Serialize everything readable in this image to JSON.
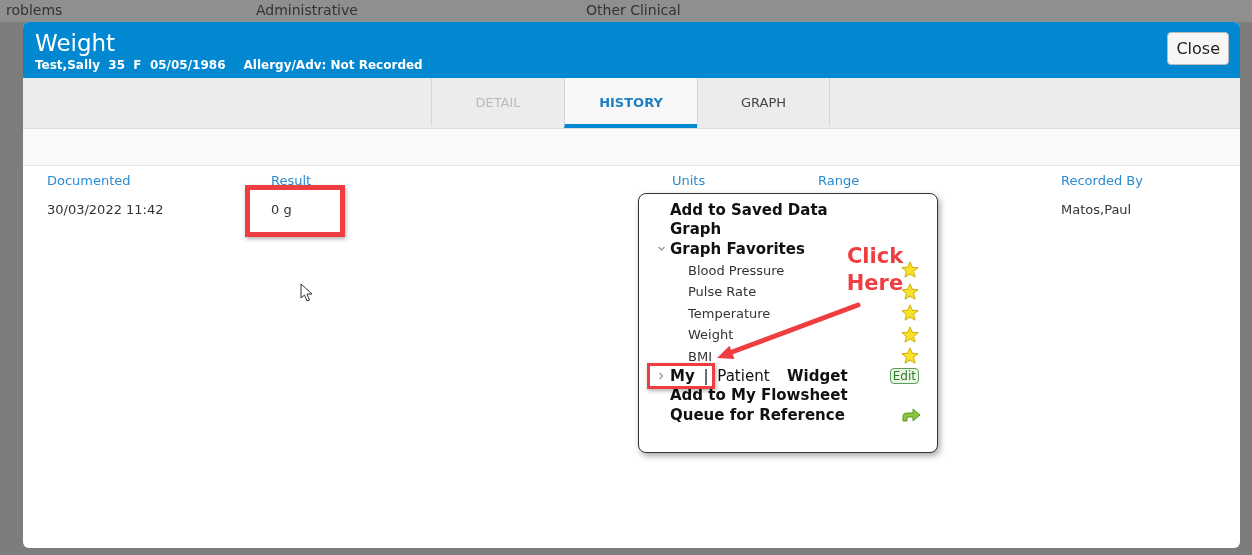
{
  "backdrop": {
    "tabs": [
      {
        "label": "roblems"
      },
      {
        "label": "Administrative"
      },
      {
        "label": "Other Clinical"
      }
    ]
  },
  "window": {
    "title": "Weight",
    "patient": "Test,Sally  35  F  05/05/1986",
    "allergy": "Allergy/Adv: Not Recorded",
    "close": "Close"
  },
  "tabs": [
    {
      "label": "DETAIL",
      "selected": false,
      "disabled": true
    },
    {
      "label": "HISTORY",
      "selected": true,
      "disabled": false
    },
    {
      "label": "GRAPH",
      "selected": false,
      "disabled": false
    }
  ],
  "table": {
    "columns": [
      "Documented",
      "Result",
      "Units",
      "Range",
      "Recorded By"
    ],
    "rows": [
      [
        "30/03/2022 11:42",
        "0 g",
        "",
        "",
        "Matos,Paul"
      ]
    ]
  },
  "context_menu": {
    "items": [
      {
        "kind": "action",
        "label": "Add to Saved Data"
      },
      {
        "kind": "action",
        "label": "Graph"
      },
      {
        "kind": "group",
        "label": "Graph Favorites",
        "expanded": true,
        "children": [
          {
            "kind": "favorite",
            "label": "Blood Pressure"
          },
          {
            "kind": "favorite",
            "label": "Pulse Rate"
          },
          {
            "kind": "favorite",
            "label": "Temperature"
          },
          {
            "kind": "favorite",
            "label": "Weight"
          },
          {
            "kind": "favorite",
            "label": "BMI"
          }
        ]
      },
      {
        "kind": "widget",
        "label": "**My** | Patient  **Widget**",
        "expanded": false,
        "button": "Edit"
      },
      {
        "kind": "action",
        "label": "Add to My Flowsheet"
      },
      {
        "kind": "queue",
        "label": "Queue for Reference"
      }
    ]
  },
  "annotation": {
    "text": "Click Here"
  }
}
